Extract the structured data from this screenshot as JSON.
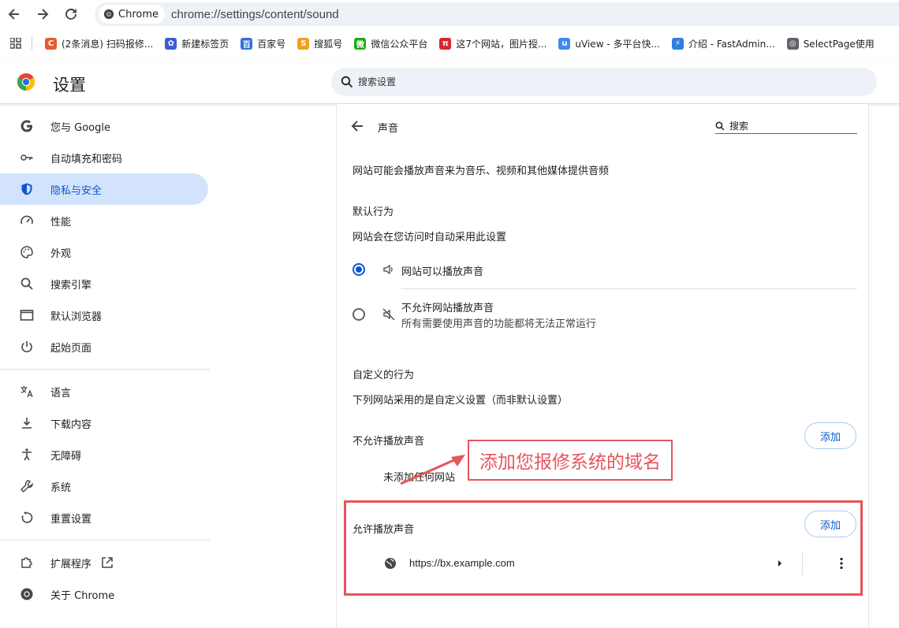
{
  "toolbar": {
    "chip_label": "Chrome",
    "url": "chrome://settings/content/sound"
  },
  "bookmarks": [
    {
      "label": "(2条消息) 扫码报修...",
      "icon_color": "#e95a2b",
      "icon_char": "C"
    },
    {
      "label": "新建标签页",
      "icon_color": "#3b5bdb",
      "icon_char": "✿"
    },
    {
      "label": "百家号",
      "icon_color": "#2f6fe0",
      "icon_char": "百"
    },
    {
      "label": "搜狐号",
      "icon_color": "#f0a020",
      "icon_char": "S"
    },
    {
      "label": "微信公众平台",
      "icon_color": "#1aad19",
      "icon_char": "微"
    },
    {
      "label": "这7个网站，图片授...",
      "icon_color": "#d9262c",
      "icon_char": "π"
    },
    {
      "label": "uView - 多平台快...",
      "icon_color": "#3c8cf0",
      "icon_char": "u"
    },
    {
      "label": "介绍 - FastAdmin...",
      "icon_color": "#2f7de1",
      "icon_char": "⚡"
    },
    {
      "label": "SelectPage使用",
      "icon_color": "#5f6368",
      "icon_char": "◎"
    }
  ],
  "header": {
    "title": "设置",
    "search_placeholder": "搜索设置"
  },
  "sidebar": {
    "items": [
      {
        "label": "您与 Google",
        "icon": "google-icon"
      },
      {
        "label": "自动填充和密码",
        "icon": "key-icon"
      },
      {
        "label": "隐私与安全",
        "icon": "shield-icon",
        "active": true
      },
      {
        "label": "性能",
        "icon": "speedometer-icon"
      },
      {
        "label": "外观",
        "icon": "palette-icon"
      },
      {
        "label": "搜索引擎",
        "icon": "search-icon"
      },
      {
        "label": "默认浏览器",
        "icon": "browser-window-icon"
      },
      {
        "label": "起始页面",
        "icon": "power-icon"
      },
      {
        "label": "语言",
        "icon": "translate-icon"
      },
      {
        "label": "下载内容",
        "icon": "download-icon"
      },
      {
        "label": "无障碍",
        "icon": "accessibility-icon"
      },
      {
        "label": "系统",
        "icon": "wrench-icon"
      },
      {
        "label": "重置设置",
        "icon": "reset-icon"
      },
      {
        "label": "扩展程序",
        "icon": "extension-icon"
      },
      {
        "label": "关于 Chrome",
        "icon": "chrome-icon"
      }
    ]
  },
  "main": {
    "title": "声音",
    "search_placeholder": "搜索",
    "description": "网站可能会播放声音来为音乐、视频和其他媒体提供音频",
    "default_heading": "默认行为",
    "default_sub": "网站会在您访问时自动采用此设置",
    "option_allow": {
      "label": "网站可以播放声音",
      "selected": true
    },
    "option_block": {
      "label": "不允许网站播放声音",
      "sub": "所有需要使用声音的功能都将无法正常运行",
      "selected": false
    },
    "custom_heading": "自定义的行为",
    "custom_sub": "下列网站采用的是自定义设置（而非默认设置）",
    "blocked_heading": "不允许播放声音",
    "blocked_empty": "未添加任何网站",
    "allowed_heading": "允许播放声音",
    "add_label": "添加",
    "allowed_sites": [
      {
        "url": "https://bx.example.com"
      }
    ]
  },
  "annotation": {
    "callout_text": "添加您报修系统的域名",
    "color": "#e7545b"
  }
}
